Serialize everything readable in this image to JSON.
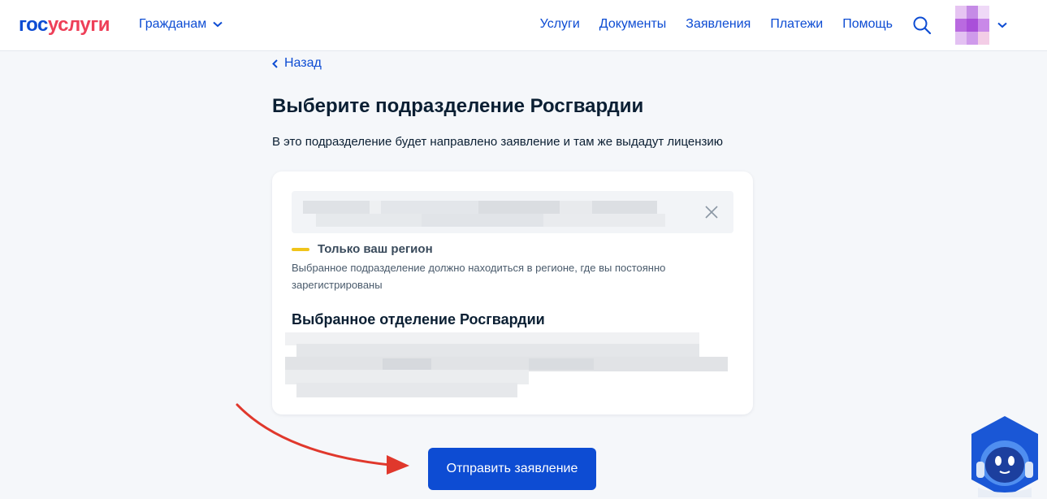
{
  "header": {
    "logo_part1": "гос",
    "logo_part2": "услуги",
    "audience_label": "Гражданам",
    "nav": [
      "Услуги",
      "Документы",
      "Заявления",
      "Платежи",
      "Помощь"
    ],
    "icons": {
      "search": "search-icon",
      "avatar": "avatar-image",
      "chevron": "chevron-down-icon"
    }
  },
  "back_label": "Назад",
  "page": {
    "title": "Выберите подразделение Росгвардии",
    "subtitle": "В это подразделение будет направлено заявление и там же выдадут лицензию"
  },
  "card": {
    "hint_title": "Только ваш регион",
    "hint_text": "Выбранное подразделение должно находиться в регионе, где вы постоянно зарегистрированы",
    "section_title": "Выбранное отделение Росгвардии"
  },
  "submit_label": "Отправить заявление",
  "colors": {
    "primary": "#0d4cd3",
    "logo_red": "#ee3f58",
    "hint_yellow": "#f0c41b",
    "arrow_red": "#e0382c"
  }
}
